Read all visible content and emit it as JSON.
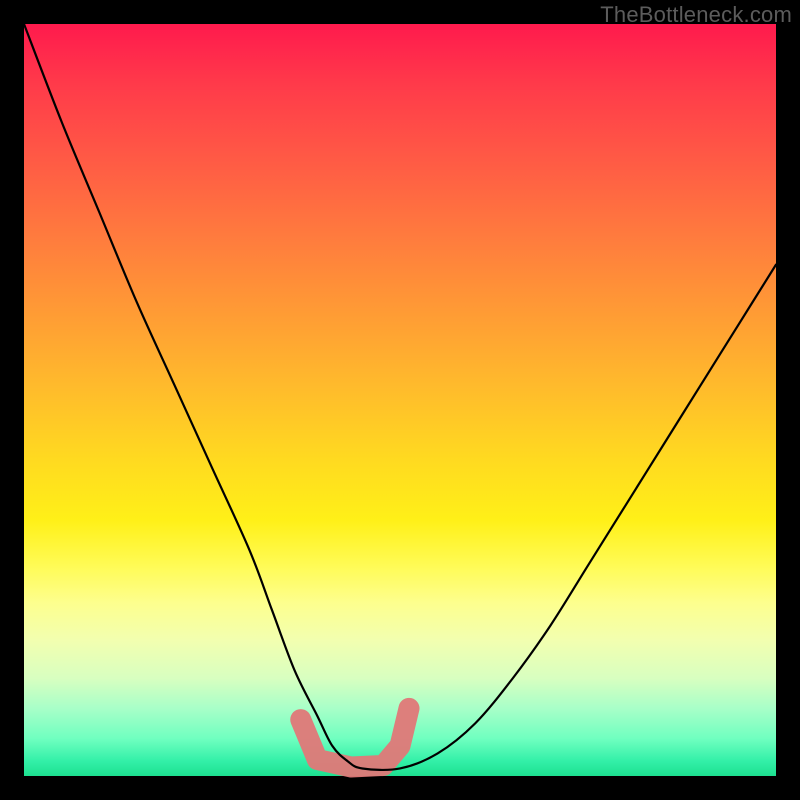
{
  "watermark": "TheBottleneck.com",
  "chart_data": {
    "type": "line",
    "title": "",
    "xlabel": "",
    "ylabel": "",
    "xlim": [
      0,
      100
    ],
    "ylim": [
      0,
      100
    ],
    "grid": false,
    "legend": null,
    "background": "heat-gradient-red-yellow-green",
    "series": [
      {
        "name": "bottleneck-curve",
        "x": [
          0,
          5,
          10,
          15,
          20,
          25,
          30,
          33,
          36,
          39,
          41,
          43,
          45,
          50,
          55,
          60,
          65,
          70,
          75,
          80,
          85,
          90,
          95,
          100
        ],
        "y": [
          100,
          87,
          75,
          63,
          52,
          41,
          30,
          22,
          14,
          8,
          4,
          2,
          1,
          1,
          3,
          7,
          13,
          20,
          28,
          36,
          44,
          52,
          60,
          68
        ]
      }
    ],
    "accent_segment": {
      "name": "optimal-range-marker",
      "color": "#e07878",
      "points_norm": [
        [
          0.368,
          0.075
        ],
        [
          0.39,
          0.022
        ],
        [
          0.435,
          0.012
        ],
        [
          0.478,
          0.014
        ],
        [
          0.5,
          0.04
        ],
        [
          0.512,
          0.09
        ]
      ]
    }
  }
}
